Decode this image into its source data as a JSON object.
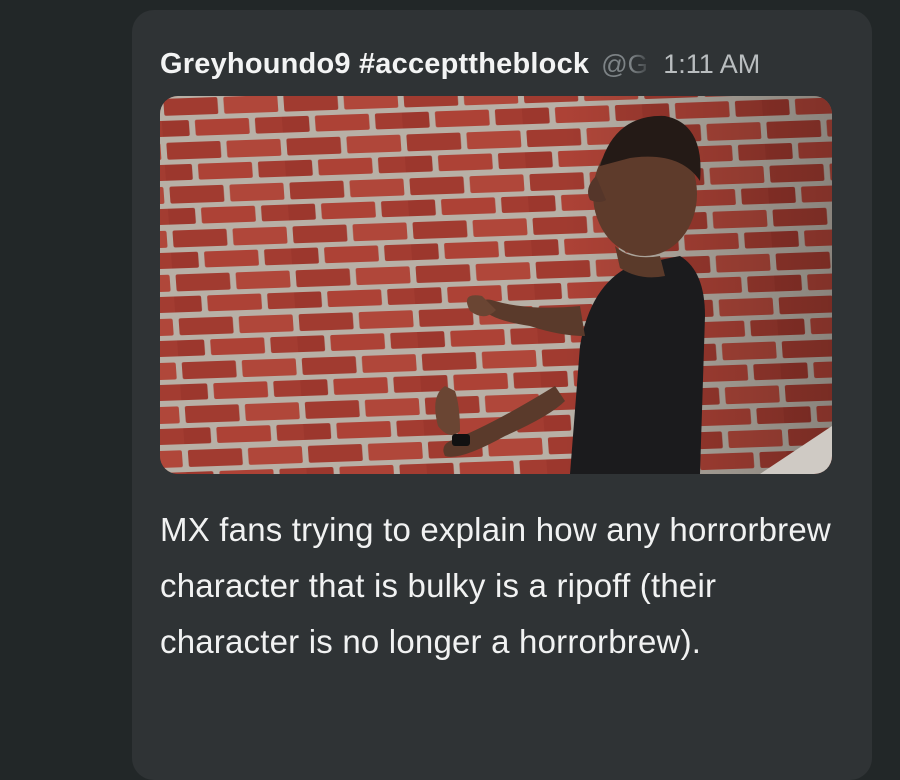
{
  "post": {
    "username": "Greyhoundo9 #accepttheblock",
    "handle": "@G",
    "timestamp": "1:11 AM",
    "media": {
      "type": "photo",
      "alt_icon": "image-icon"
    },
    "text": "MX fans trying to explain how any horrorbrew character that is bulky is a ripoff (their character is no longer a horrorbrew)."
  },
  "colors": {
    "page_bg": "#222728",
    "card_bg": "#2f3335",
    "username": "#f3f4f4",
    "handle": "#7d8386",
    "timestamp": "#b9bdbf",
    "body_text": "#f1f2f2"
  }
}
